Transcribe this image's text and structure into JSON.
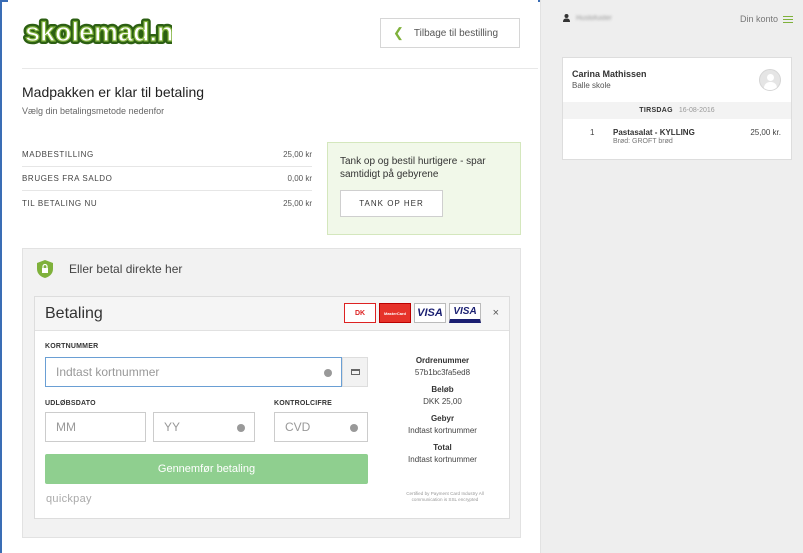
{
  "brand": {
    "logo_text": "skolemad.nu",
    "accent": "#7fb13b",
    "accent_dark": "#2c5f13"
  },
  "header": {
    "back_label": "Tilbage til bestilling"
  },
  "page": {
    "title": "Madpakken er klar til betaling",
    "subtitle": "Vælg din betalingsmetode nedenfor"
  },
  "summary": [
    {
      "label": "MADBESTILLING",
      "value": "25,00 kr"
    },
    {
      "label": "BRUGES FRA SALDO",
      "value": "0,00 kr"
    },
    {
      "label": "TIL BETALING NU",
      "value": "25,00 kr"
    }
  ],
  "topup": {
    "text": "Tank op og bestil hurtigere - spar samtidigt på gebyrene",
    "button": "TANK OP HER"
  },
  "direct": {
    "title": "Eller betal direkte her"
  },
  "payment": {
    "title": "Betaling",
    "cards": [
      "DK",
      "MasterCard",
      "VISA",
      "VISA"
    ],
    "close": "×",
    "card_number_label": "KORTNUMMER",
    "card_number_placeholder": "Indtast kortnummer",
    "expiry_label": "UDLØBSDATO",
    "month_placeholder": "MM",
    "year_placeholder": "YY",
    "cvd_label": "KONTROLCIFRE",
    "cvd_placeholder": "CVD",
    "submit": "Gennemfør betaling",
    "provider": "quickpay",
    "info": [
      {
        "key": "Ordrenummer",
        "value": "57b1bc3fa5ed8"
      },
      {
        "key": "Beløb",
        "value": "DKK 25,00"
      },
      {
        "key": "Gebyr",
        "value": "Indtast kortnummer"
      },
      {
        "key": "Total",
        "value": "Indtast kortnummer"
      }
    ],
    "certification": "Certified by Payment Card Industry All communication is SSL encrypted"
  },
  "sidebar": {
    "username": "Hustofuster",
    "account": "Din konto",
    "order": {
      "name": "Carina Mathissen",
      "school": "Balle skole",
      "day": "TIRSDAG",
      "date": "16-08-2016",
      "items": [
        {
          "qty": "1",
          "name": "Pastasalat - KYLLING",
          "sub": "Brød: GROFT brød",
          "price": "25,00 kr."
        }
      ]
    }
  }
}
